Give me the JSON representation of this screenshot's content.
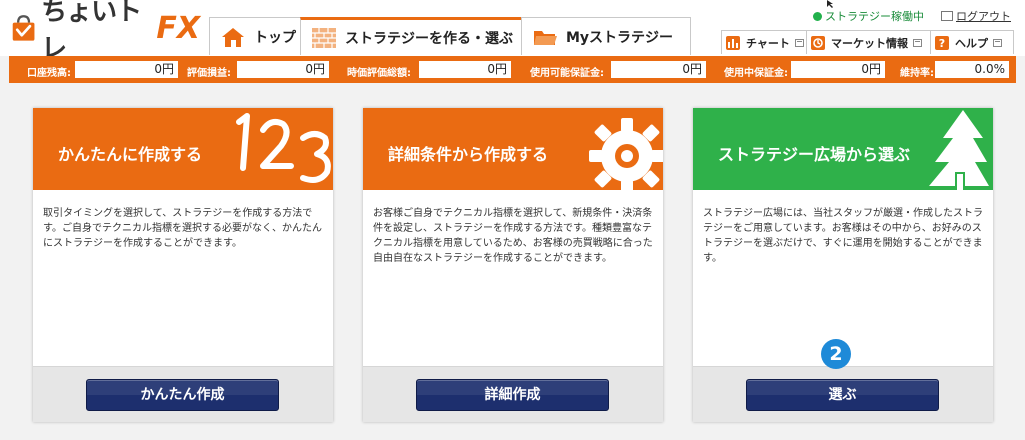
{
  "header": {
    "logo_text": "ちょいトレ",
    "logo_fx": "FX",
    "tabs": [
      {
        "label": "トップ",
        "icon": "house-icon"
      },
      {
        "label": "ストラテジーを作る・選ぶ",
        "icon": "brick-wall-icon"
      },
      {
        "label": "Myストラテジー",
        "icon": "folder-icon"
      }
    ],
    "status_text": "ストラテジー稼働中",
    "logout_label": "ログアウト",
    "util_buttons": [
      {
        "label": "チャート",
        "icon": "chart-icon"
      },
      {
        "label": "マーケット情報",
        "icon": "market-icon"
      },
      {
        "label": "ヘルプ",
        "icon": "help-icon"
      }
    ]
  },
  "statbar": {
    "items": [
      {
        "label": "口座残高:",
        "value": "0円"
      },
      {
        "label": "評価損益:",
        "value": "0円"
      },
      {
        "label": "時価評価総額:",
        "value": "0円"
      },
      {
        "label": "使用可能保証金:",
        "value": "0円"
      },
      {
        "label": "使用中保証金:",
        "value": "0円"
      },
      {
        "label": "維持率:",
        "value": "0.0%"
      }
    ]
  },
  "cards": [
    {
      "title": "かんたんに作成する",
      "description": "取引タイミングを選択して、ストラテジーを作成する方法です。ご自身でテクニカル指標を選択する必要がなく、かんたんにストラテジーを作成することができます。",
      "button_label": "かんたん作成",
      "header_color": "#ea6b12"
    },
    {
      "title": "詳細条件から作成する",
      "description": "お客様ご自身でテクニカル指標を選択して、新規条件・決済条件を設定し、ストラテジーを作成する方法です。種類豊富なテクニカル指標を用意しているため、お客様の売買戦略に合った自由自在なストラテジーを作成することができます。",
      "button_label": "詳細作成",
      "header_color": "#ea6b12"
    },
    {
      "title": "ストラテジー広場から選ぶ",
      "description": "ストラテジー広場には、当社スタッフが厳選・作成したストラテジーをご用意しています。お客様はその中から、お好みのストラテジーを選ぶだけで、すぐに運用を開始することができます。",
      "button_label": "選ぶ",
      "header_color": "#2fb14a"
    }
  ],
  "step_badge": "2",
  "colors": {
    "brand_orange": "#ea6b12",
    "brand_green": "#2fb14a",
    "button_navy": "#1d2f6e",
    "step_blue": "#1e8ad8"
  }
}
